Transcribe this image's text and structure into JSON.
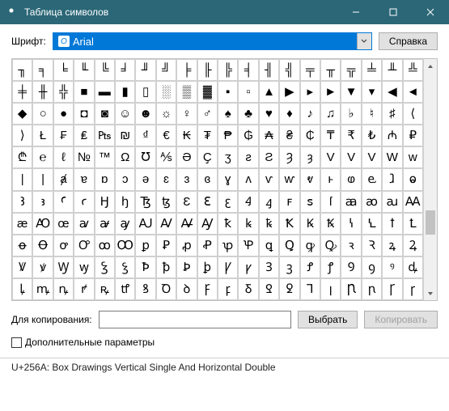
{
  "window": {
    "title": "Таблица символов"
  },
  "toolbar": {
    "font_label": "Шрифт:",
    "font_selected": "Arial",
    "help_label": "Справка"
  },
  "grid": {
    "rows": [
      [
        "╖",
        "╕",
        "╘",
        "╙",
        "╚",
        "╛",
        "╜",
        "╝",
        "╞",
        "╟",
        "╠",
        "╡",
        "╢",
        "╣",
        "╤",
        "╥",
        "╦",
        "╧",
        "╨",
        "╩"
      ],
      [
        "╪",
        "╫",
        "╬",
        "■",
        "▬",
        "▮",
        "▯",
        "░",
        "▒",
        "▓",
        "▪",
        "▫",
        "▲",
        "▶",
        "▸",
        "►",
        "▼",
        "▾",
        "◀",
        "◄"
      ],
      [
        "◆",
        "○",
        "●",
        "◘",
        "◙",
        "☺",
        "☻",
        "☼",
        "♀",
        "♂",
        "♠",
        "♣",
        "♥",
        "♦",
        "♪",
        "♫",
        "♭",
        "♮",
        "♯",
        "⟨"
      ],
      [
        "⟩",
        "Ł",
        "₣",
        "₤",
        "₧",
        "₪",
        "₫",
        "€",
        "₭",
        "₮",
        "₱",
        "₲",
        "₳",
        "₴",
        "₵",
        "₸",
        "₹",
        "₺",
        "₼",
        "₽"
      ],
      [
        "₾",
        "℮",
        "ℓ",
        "№",
        "™",
        "Ω",
        "℧",
        "⅍",
        "Ә",
        "Ҫ",
        "ʒ",
        "ƨ",
        "Ƨ",
        "Ȝ",
        "ȝ",
        "V",
        "V",
        "V",
        "W",
        "w"
      ],
      [
        "|",
        "|",
        "ⱥ",
        "ɐ",
        "ɒ",
        "ɔ",
        "ə",
        "ɛ",
        "ɜ",
        "ɞ",
        "ɣ",
        "ʌ",
        "ⱱ",
        "ⱳ",
        "ⱴ",
        "ⱶ",
        "ⱷ",
        "ⱸ",
        "ⱹ",
        "ⱺ"
      ],
      [
        "Ꜣ",
        "ꜣ",
        "Ꜥ",
        "ꜥ",
        "Ꜧ",
        "ꜧ",
        "Ꜩ",
        "ꜩ",
        "Ɛ",
        "Ꜫ",
        "ꜫ",
        "Ꜭ",
        "ꜭ",
        "ꜰ",
        "ꜱ",
        "ſ",
        "ꜳ",
        "ꜵ",
        "ꜷ",
        "Ꜳ"
      ],
      [
        "æ",
        "Ꜵ",
        "œ",
        "ꜹ",
        "ꜻ",
        "ꜽ",
        "Ꜷ",
        "Ꜹ",
        "Ꜻ",
        "Ꜽ",
        "ꝁ",
        "ꝃ",
        "ꝅ",
        "Ꝁ",
        "Ꝃ",
        "Ꝅ",
        "ꝇ",
        "Ꝇ",
        "ꝉ",
        "Ꝉ"
      ],
      [
        "ꝋ",
        "Ꝋ",
        "ꝍ",
        "Ꝍ",
        "ꝏ",
        "Ꝏ",
        "ꝑ",
        "Ꝑ",
        "ꝓ",
        "Ꝓ",
        "ꝕ",
        "Ꝕ",
        "ꝗ",
        "Ꝗ",
        "ꝙ",
        "Ꝙ",
        "ꝛ",
        "Ꝛ",
        "ꝝ",
        "Ꝝ"
      ],
      [
        "Ꝟ",
        "ꝟ",
        "Ꝡ",
        "ꝡ",
        "Ꝣ",
        "ꝣ",
        "Ꝥ",
        "ꝥ",
        "Ꝧ",
        "ꝧ",
        "Ꝩ",
        "ꝩ",
        "Ꝫ",
        "ꝫ",
        "Ꝭ",
        "ꝭ",
        "Ꝯ",
        "ꝯ",
        "ꝰ",
        "ꝱ"
      ],
      [
        "ꝲ",
        "ꝳ",
        "ꝴ",
        "ꝵ",
        "ꝶ",
        "ꝷ",
        "ꝸ",
        "Ꝺ",
        "ꝺ",
        "Ꝼ",
        "ꝼ",
        "Ᵹ",
        "Ꝿ",
        "ꝿ",
        "Ꞁ",
        "ꞁ",
        "Ꞃ",
        "ꞃ",
        "Ꞅ",
        "ꞅ"
      ]
    ]
  },
  "copy": {
    "label": "Для копирования:",
    "value": "",
    "select_label": "Выбрать",
    "copy_label": "Копировать"
  },
  "advanced": {
    "label": "Дополнительные параметры"
  },
  "status": {
    "text": "U+256A: Box Drawings Vertical Single And Horizontal Double"
  }
}
